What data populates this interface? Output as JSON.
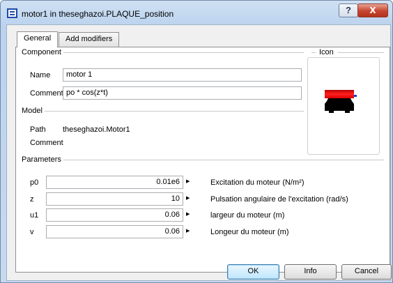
{
  "window": {
    "title": "motor1 in theseghazoi.PLAQUE_position",
    "help_glyph": "?",
    "close_glyph": "X"
  },
  "tabs": [
    {
      "label": "General",
      "active": true
    },
    {
      "label": "Add modifiers",
      "active": false
    }
  ],
  "component": {
    "section_label": "Component",
    "name_label": "Name",
    "name_value": "motor 1",
    "comment_label": "Comment",
    "comment_value": "po * cos(z*t)"
  },
  "icon_section": {
    "label": "Icon",
    "colors": {
      "red": "#e01010",
      "black": "#000000",
      "blue": "#1840d8"
    }
  },
  "model": {
    "section_label": "Model",
    "path_label": "Path",
    "path_value": "theseghazoi.Motor1",
    "comment_label": "Comment"
  },
  "parameters": {
    "section_label": "Parameters",
    "rows": [
      {
        "name": "p0",
        "value": "0.01e6",
        "description": "Excitation du moteur (N/m²)"
      },
      {
        "name": "z",
        "value": "10",
        "description": "Pulsation angulaire de l'excitation (rad/s)"
      },
      {
        "name": "u1",
        "value": "0.06",
        "description": "largeur du moteur (m)"
      },
      {
        "name": "v",
        "value": "0.06",
        "description": "Longeur du moteur (m)"
      }
    ]
  },
  "buttons": {
    "ok": "OK",
    "info": "Info",
    "cancel": "Cancel"
  }
}
